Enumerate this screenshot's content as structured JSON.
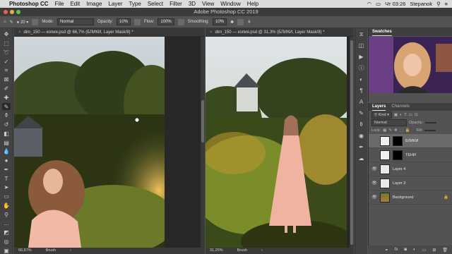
{
  "menubar": {
    "apple_icon": "apple-icon",
    "app_name": "Photoshop CC",
    "items": [
      "File",
      "Edit",
      "Image",
      "Layer",
      "Type",
      "Select",
      "Filter",
      "3D",
      "View",
      "Window",
      "Help"
    ],
    "time": "Чт 03:26",
    "user": "Stepanok"
  },
  "window": {
    "title": "Adobe Photoshop CC 2019"
  },
  "options": {
    "brush_size": "20",
    "mode_label": "Mode:",
    "mode_value": "Normal",
    "opacity_label": "Opacity:",
    "opacity_value": "10%",
    "flow_label": "Flow:",
    "flow_value": "100%",
    "smoothing_label": "Smoothing:",
    "smoothing_value": "10%"
  },
  "doc_left": {
    "tab": "dim_150 — копия.psd @ 66,7% (БЛИКИ, Layer Mask/8) *",
    "zoom": "66,67%",
    "tool": "Brush"
  },
  "doc_right": {
    "tab": "dim_150 — копия.psd @ 31,3% (БЛИКИ, Layer Mask/8) *",
    "zoom": "31,25%",
    "tool": "Brush"
  },
  "panels": {
    "swatches_title": "Swatches",
    "layers_tab": "Layers",
    "channels_tab": "Channels",
    "kind_label": "Kind",
    "blend_mode": "Normal",
    "opacity_label": "Opacity:",
    "fill_label": "Fill:",
    "lock_label": "Lock:"
  },
  "layers": [
    {
      "name": "БЛИКИ",
      "selected": true,
      "visible": false
    },
    {
      "name": "ТЕНИ",
      "selected": false,
      "visible": false
    },
    {
      "name": "Layer 4",
      "selected": false,
      "visible": true
    },
    {
      "name": "Layer 3",
      "selected": false,
      "visible": true
    },
    {
      "name": "Background",
      "selected": false,
      "visible": true
    }
  ],
  "footer_icons": [
    "link-icon",
    "fx-icon",
    "mask-icon",
    "adjustment-icon",
    "folder-icon",
    "new-layer-icon",
    "trash-icon"
  ],
  "colors": {
    "ui_dark": "#424242",
    "ui_mid": "#535353",
    "selection": "#6b6b6b"
  }
}
